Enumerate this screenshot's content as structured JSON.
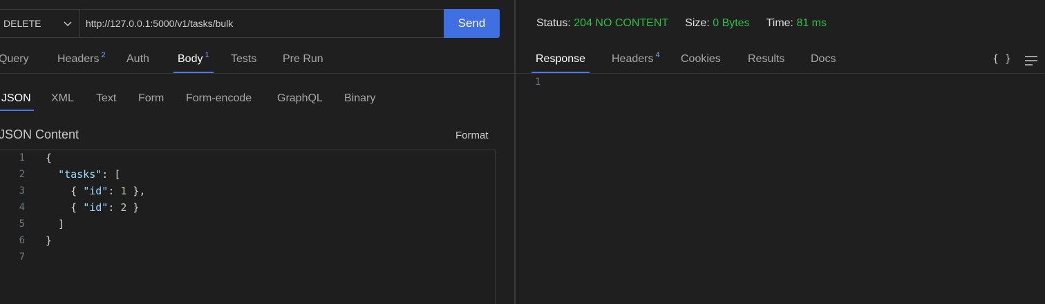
{
  "request": {
    "method": "DELETE",
    "url": "http://127.0.0.1:5000/v1/tasks/bulk",
    "send_label": "Send"
  },
  "request_tabs": [
    {
      "label": "Query",
      "badge": ""
    },
    {
      "label": "Headers",
      "badge": "2"
    },
    {
      "label": "Auth",
      "badge": ""
    },
    {
      "label": "Body",
      "badge": "1",
      "active": true
    },
    {
      "label": "Tests",
      "badge": ""
    },
    {
      "label": "Pre Run",
      "badge": ""
    }
  ],
  "body_tabs": [
    "JSON",
    "XML",
    "Text",
    "Form",
    "Form-encode",
    "GraphQL",
    "Binary"
  ],
  "body_active": "JSON",
  "editor": {
    "label": "JSON Content",
    "format_label": "Format",
    "line_numbers": [
      "1",
      "2",
      "3",
      "4",
      "5",
      "6",
      "7"
    ]
  },
  "response": {
    "status_label": "Status:",
    "status_value": "204 NO CONTENT",
    "size_label": "Size:",
    "size_value": "0 Bytes",
    "time_label": "Time:",
    "time_value": "81 ms",
    "line_numbers": [
      "1"
    ]
  },
  "response_tabs": [
    {
      "label": "Response",
      "badge": "",
      "active": true
    },
    {
      "label": "Headers",
      "badge": "4"
    },
    {
      "label": "Cookies",
      "badge": ""
    },
    {
      "label": "Results",
      "badge": ""
    },
    {
      "label": "Docs",
      "badge": ""
    }
  ],
  "icons": {
    "braces": "{ }",
    "wrap": "wrap-lines-icon",
    "dropdown": "chevron-down-icon"
  },
  "colors": {
    "accent": "#3f6fe0",
    "status_ok": "#2fbf4b",
    "background": "#1f1f1f"
  }
}
